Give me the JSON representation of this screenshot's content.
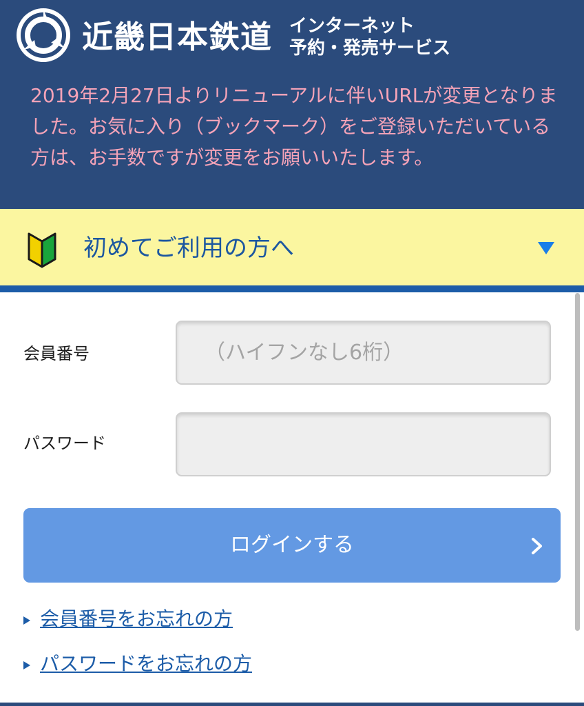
{
  "header": {
    "brand_name": "近畿日本鉄道",
    "service_line1": "インターネット",
    "service_line2": "予約・発売サービス",
    "notice": "2019年2月27日よりリニューアルに伴いURLが変更となりました。お気に入り（ブックマーク）をご登録いただいている方は、お手数ですが変更をお願いいたします。"
  },
  "beginner": {
    "label": "初めてご利用の方へ",
    "icon": "beginner-mark-icon",
    "expand_icon": "triangle-down-icon"
  },
  "form": {
    "member_label": "会員番号",
    "member_placeholder": "（ハイフンなし6桁）",
    "member_value": "",
    "password_label": "パスワード",
    "password_value": "",
    "login_label": "ログインする",
    "login_icon": "chevron-right-icon"
  },
  "links": {
    "forgot_member": "会員番号をお忘れの方",
    "forgot_password": "パスワードをお忘れの方"
  },
  "colors": {
    "header_bg": "#2b4b7c",
    "notice_text": "#f5a3b8",
    "banner_bg": "#fbf6a0",
    "accent_blue": "#1c5ca8",
    "button_bg": "#6399e3"
  }
}
